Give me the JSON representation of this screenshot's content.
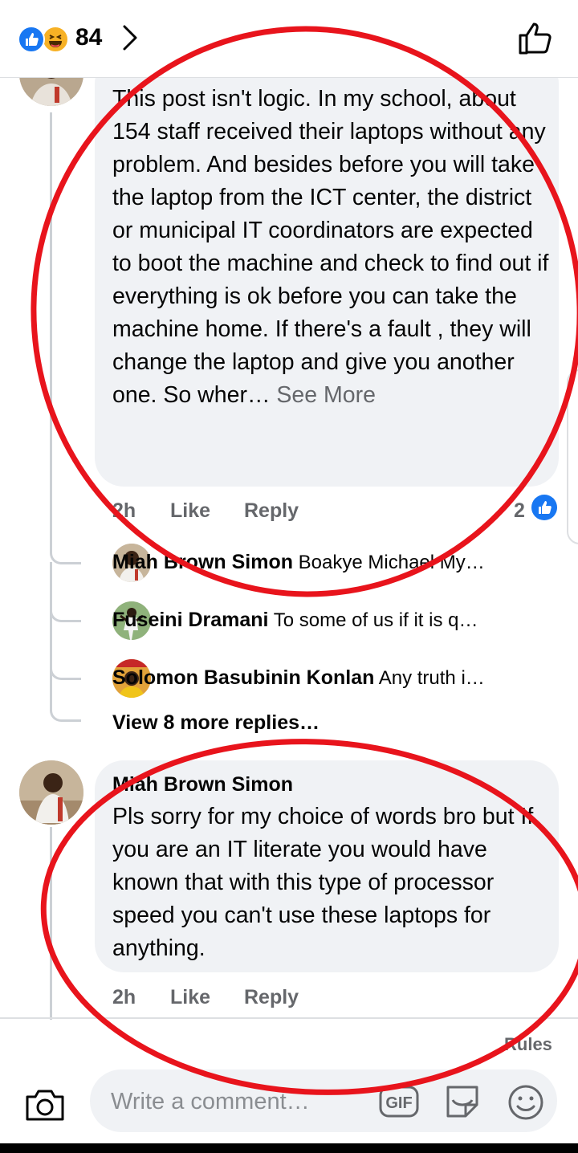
{
  "header": {
    "reaction_count": "84",
    "icons": [
      "like-reaction-icon",
      "haha-reaction-icon",
      "chevron-right-icon",
      "thumbs-up-icon"
    ]
  },
  "comments": [
    {
      "text": "This post isn't logic. In my school, about 154 staff received their laptops without any problem. And besides before you will take the laptop from the ICT center, the district or municipal IT coordinators are expected to boot the machine and check to find out if everything is ok before you can take the machine home. If there's a fault , they will change the laptop and give you another one.  So wher…",
      "see_more": "See More",
      "time": "2h",
      "like_label": "Like",
      "reply_label": "Reply",
      "like_count": "2"
    },
    {
      "author": "Miah Brown Simon",
      "text": "Pls sorry for my choice of words bro but If you are an IT literate you would have known that with this type of processor speed you can't use these laptops for anything.",
      "time": "2h",
      "like_label": "Like",
      "reply_label": "Reply"
    }
  ],
  "replies": [
    {
      "author": "Miah Brown Simon",
      "preview": "Boakye Michael My…"
    },
    {
      "author": "Fuseini Dramani",
      "preview": "To some of us if it is q…"
    },
    {
      "author": "Solomon Basubinin Konlan",
      "preview": "Any truth i…"
    }
  ],
  "view_more_replies": "View 8 more replies…",
  "composer": {
    "rules_label": "Rules",
    "placeholder": "Write a comment…",
    "gif_label": "GIF"
  },
  "colors": {
    "accent": "#1877f2",
    "bubble": "#f0f2f5",
    "annotation": "#e8141c",
    "muted": "#65676b"
  }
}
